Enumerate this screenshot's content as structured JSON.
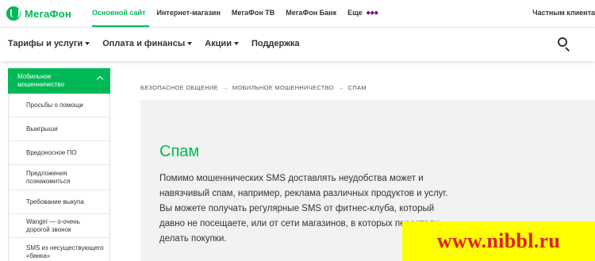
{
  "brand": {
    "logo_text": "МегаФон",
    "accent_color": "#00b956"
  },
  "topbar": {
    "links": [
      {
        "label": "Основной сайт",
        "active": true
      },
      {
        "label": "Интернет-магазин"
      },
      {
        "label": "МегаФон ТВ"
      },
      {
        "label": "МегаФон Банк"
      },
      {
        "label": "Еще"
      }
    ],
    "more_icon": "more-dots-icon",
    "private_clients": "Частным клиента"
  },
  "nav": {
    "items": [
      {
        "label": "Тарифы и услуги"
      },
      {
        "label": "Оплата и финансы"
      },
      {
        "label": "Акции"
      },
      {
        "label": "Поддержка"
      }
    ],
    "search_icon": "search-icon"
  },
  "sidebar": {
    "header": "Мобильное мошенничество",
    "items": [
      {
        "label": "Просьбы о помощи"
      },
      {
        "label": "Выигрыши"
      },
      {
        "label": "Вредоносное ПО"
      },
      {
        "label": "Предложения познакомиться"
      },
      {
        "label": "Требование выкупа"
      },
      {
        "label": "Wangiri — о-очень дорогой звонок"
      },
      {
        "label": "SMS из несуществующего «банка»"
      }
    ]
  },
  "breadcrumb": {
    "items": [
      "БЕЗОПАСНОЕ ОБЩЕНИЕ",
      "МОБИЛЬНОЕ МОШЕННИЧЕСТВО",
      "СПАМ"
    ],
    "separator": "→"
  },
  "content": {
    "title": "Спам",
    "text": "Помимо мошеннических SMS доставлять неудобства может и навязчивый спам, например, реклама различных продуктов и услуг. Вы можете получать регулярные SMS от фитнес-клуба, который давно не посещаете, или от сети магазинов, в которых перестали делать покупки."
  },
  "watermark": {
    "text": "www.nibbl.ru",
    "background": "#ffff00",
    "color": "#e02020"
  }
}
